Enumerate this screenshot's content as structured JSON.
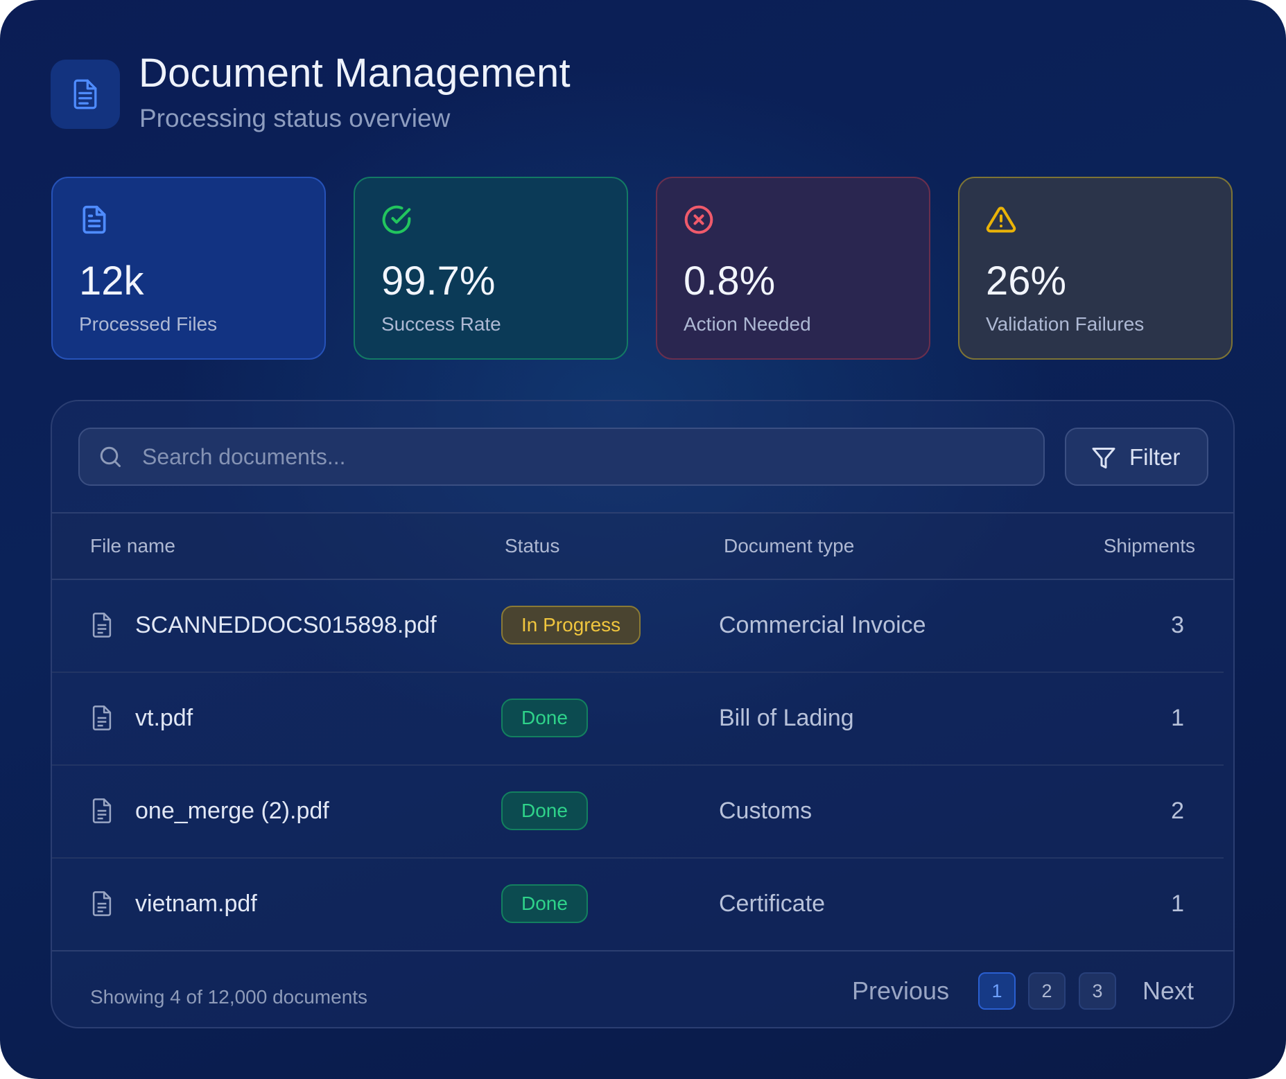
{
  "header": {
    "title": "Document Management",
    "subtitle": "Processing status overview"
  },
  "stats": [
    {
      "value": "12k",
      "label": "Processed Files",
      "icon": "document-icon",
      "color": "#4f8cff"
    },
    {
      "value": "99.7%",
      "label": "Success Rate",
      "icon": "check-circle-icon",
      "color": "#22c55e"
    },
    {
      "value": "0.8%",
      "label": "Action Needed",
      "icon": "x-circle-icon",
      "color": "#f05a6b"
    },
    {
      "value": "26%",
      "label": "Validation Failures",
      "icon": "warning-triangle-icon",
      "color": "#eab308"
    }
  ],
  "search": {
    "placeholder": "Search documents..."
  },
  "filter": {
    "label": "Filter"
  },
  "table": {
    "columns": [
      "File name",
      "Status",
      "Document type",
      "Shipments"
    ],
    "rows": [
      {
        "file": "SCANNEDDOCS015898.pdf",
        "status": "In Progress",
        "type": "Commercial Invoice",
        "shipments": "3"
      },
      {
        "file": "vt.pdf",
        "status": "Done",
        "type": "Bill of Lading",
        "shipments": "1"
      },
      {
        "file": "one_merge (2).pdf",
        "status": "Done",
        "type": "Customs",
        "shipments": "2"
      },
      {
        "file": "vietnam.pdf",
        "status": "Done",
        "type": "Certificate",
        "shipments": "1"
      }
    ]
  },
  "footer": {
    "showing": "Showing 4 of 12,000 documents",
    "previous": "Previous",
    "next": "Next",
    "pages": [
      "1",
      "2",
      "3"
    ],
    "current_page": "1"
  }
}
